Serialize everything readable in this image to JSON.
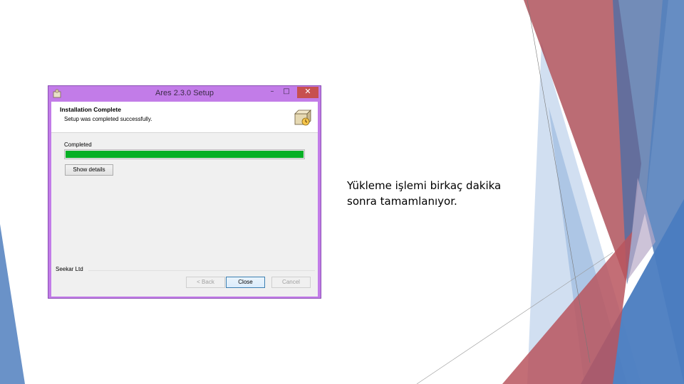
{
  "window": {
    "title": "Ares 2.3.0 Setup",
    "controls": {
      "minimize": "–",
      "maximize": "□",
      "close": "✕"
    },
    "accent_color": "#c27ce8"
  },
  "header": {
    "title": "Installation Complete",
    "subtitle": "Setup was completed successfully.",
    "icon": "installer-box-icon"
  },
  "status": {
    "label": "Completed",
    "progress": 1.0,
    "progress_color": "#06b025"
  },
  "buttons": {
    "show_details": "Show details",
    "back": "< Back",
    "close": "Close",
    "cancel": "Cancel"
  },
  "publisher": "Seekar Ltd",
  "slide": {
    "line1": "Yükleme işlemi birkaç dakika",
    "line2": "sonra tamamlanıyor."
  },
  "decor_colors": {
    "red": "#a43b45",
    "blue": "#4f81bd",
    "light_blue": "#a9c4e4"
  }
}
